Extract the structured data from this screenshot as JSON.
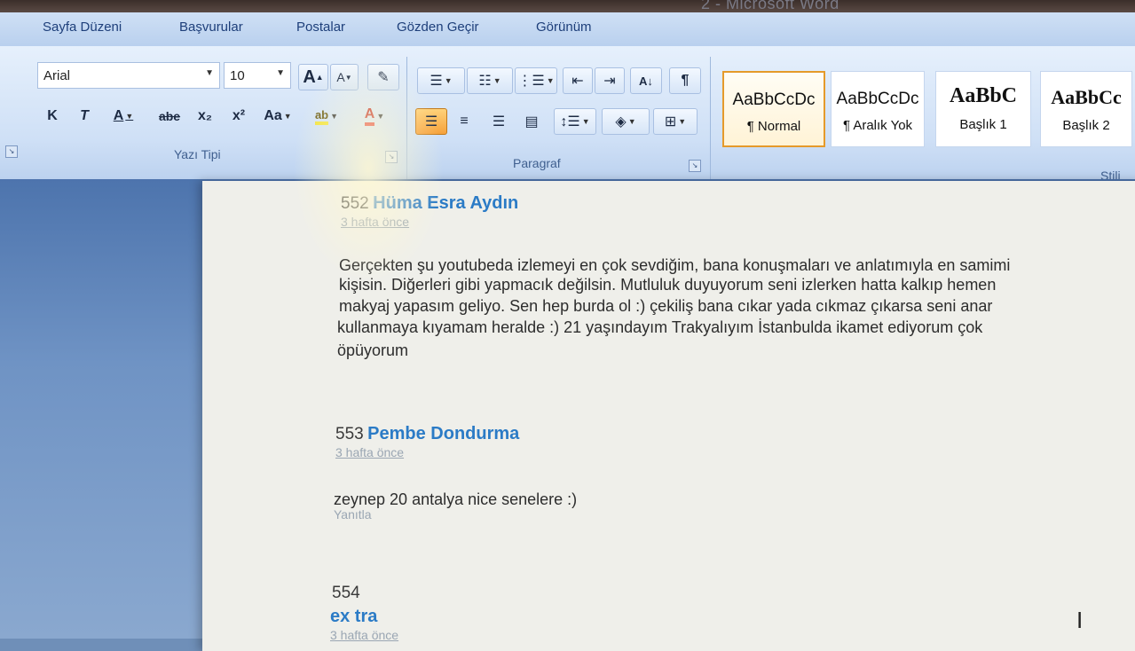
{
  "window": {
    "title": "2 - Microsoft Word"
  },
  "tabs": [
    "Sayfa Düzeni",
    "Başvurular",
    "Postalar",
    "Gözden Geçir",
    "Görünüm"
  ],
  "font_group": {
    "font_name": "Arial",
    "font_size": "10",
    "label": "Yazı Tipi",
    "buttons": {
      "grow": "A",
      "shrink": "A",
      "bold": "K",
      "italic": "T",
      "underline": "A",
      "strike": "abe",
      "subscript": "x₂",
      "superscript": "x²",
      "change_case": "Aa"
    }
  },
  "paragraph_group": {
    "label": "Paragraf",
    "pilcrow": "¶"
  },
  "styles_group": {
    "label": "Stili",
    "items": [
      {
        "sample": "AaBbCcDc",
        "name": "¶ Normal"
      },
      {
        "sample": "AaBbCcDc",
        "name": "¶ Aralık Yok"
      },
      {
        "sample": "AaBbC",
        "name": "Başlık 1"
      },
      {
        "sample": "AaBbCc",
        "name": "Başlık 2"
      }
    ]
  },
  "document": {
    "comments": [
      {
        "number": "552",
        "author": "Hüma Esra Aydın",
        "time": "3 hafta önce",
        "lines": [
          "Gerçekten şu youtubeda izlemeyi en çok sevdiğim, bana konuşmaları ve anlatımıyla en samimi",
          "kişisin. Diğerleri gibi yapmacık değilsin. Mutluluk duyuyorum seni izlerken hatta kalkıp hemen",
          "makyaj yapasım geliyo. Sen hep burda ol :) çekiliş bana cıkar yada cıkmaz çıkarsa seni anar",
          "kullanmaya kıyamam heralde :) 21 yaşındayım Trakyalıyım İstanbulda ikamet ediyorum çok",
          "öpüyorum"
        ]
      },
      {
        "number": "553",
        "author": "Pembe Dondurma",
        "time": "3 hafta önce",
        "lines": [
          "zeynep 20 antalya nice senelere :)"
        ],
        "reply": "Yanıtla"
      },
      {
        "number": "554",
        "author": "ex tra",
        "time": "3 hafta önce"
      }
    ]
  },
  "colors": {
    "accent": "#2b7bc6",
    "ribbon": "#cfe0f6",
    "workspace": "#5a80b6"
  }
}
